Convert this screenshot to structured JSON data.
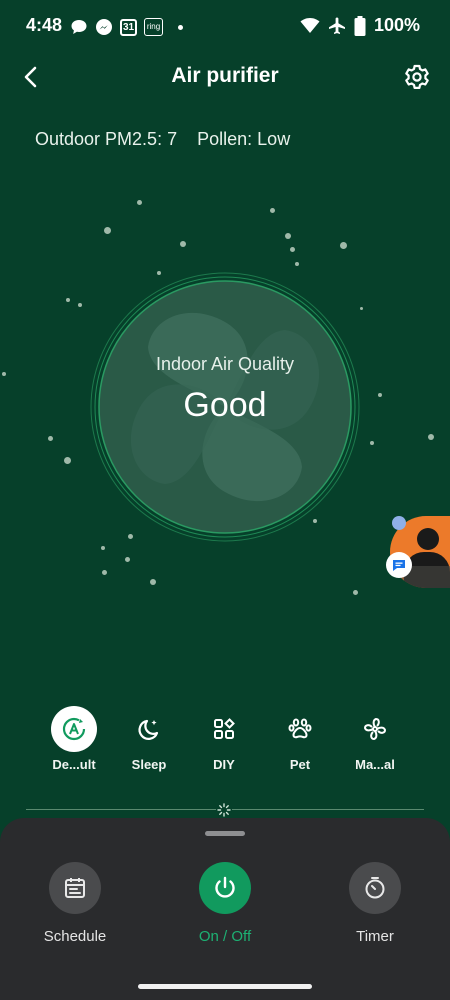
{
  "status_bar": {
    "time": "4:48",
    "notification_icons": [
      "chat-bubble-icon",
      "messenger-icon",
      "calendar-icon",
      "ring-icon",
      "dot-icon"
    ],
    "calendar_day": "31",
    "ring_label": "ring",
    "right_icons": [
      "wifi-icon",
      "airplane-icon",
      "battery-icon"
    ],
    "battery": "100%"
  },
  "header": {
    "title": "Air purifier"
  },
  "outdoor": {
    "pm_label": "Outdoor PM2.5:",
    "pm_value": "7",
    "pollen_label": "Pollen:",
    "pollen_value": "Low"
  },
  "air_quality": {
    "label": "Indoor Air Quality",
    "value": "Good"
  },
  "modes": [
    {
      "label": "De...ult",
      "icon": "auto-mode-icon",
      "active": true
    },
    {
      "label": "Sleep",
      "icon": "moon-icon",
      "active": false
    },
    {
      "label": "DIY",
      "icon": "diy-grid-icon",
      "active": false
    },
    {
      "label": "Pet",
      "icon": "paw-icon",
      "active": false
    },
    {
      "label": "Ma...al",
      "icon": "fan-icon",
      "active": false
    }
  ],
  "bottom": {
    "schedule": "Schedule",
    "power": "On / Off",
    "timer": "Timer"
  },
  "colors": {
    "background": "#06402a",
    "accent": "#119a5e",
    "sheet": "#2a2b2d"
  }
}
